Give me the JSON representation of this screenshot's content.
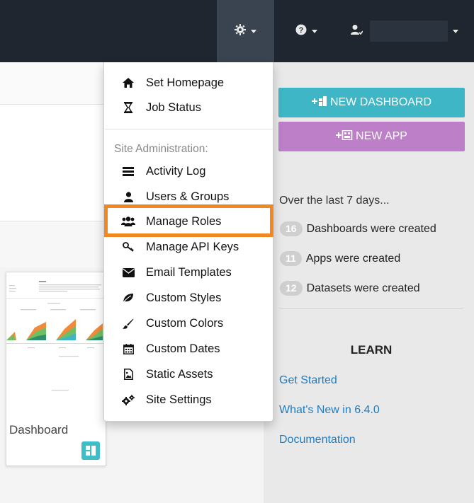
{
  "colors": {
    "topbar": "#1f2630",
    "settings_active": "#394450",
    "new_dashboard_button": "#3fb6c5",
    "new_app_button": "#bd7fc7",
    "link": "#1f7cc2",
    "highlight": "#f18721",
    "stat_pill": "#cfcfcf"
  },
  "topbar": {
    "settings_icon": "gear-icon",
    "help_icon": "question-circle-icon",
    "user_icon": "user-icon"
  },
  "menu": {
    "items_top": [
      {
        "icon": "home-icon",
        "label": "Set Homepage"
      },
      {
        "icon": "hourglass-icon",
        "label": "Job Status"
      }
    ],
    "section_header": "Site Administration:",
    "items_admin": [
      {
        "icon": "list-icon",
        "label": "Activity Log"
      },
      {
        "icon": "user-icon",
        "label": "Users & Groups"
      },
      {
        "icon": "users-icon",
        "label": "Manage Roles",
        "highlighted": true
      },
      {
        "icon": "key-icon",
        "label": "Manage API Keys"
      },
      {
        "icon": "envelope-icon",
        "label": "Email Templates"
      },
      {
        "icon": "leaf-icon",
        "label": "Custom Styles"
      },
      {
        "icon": "paintbrush-icon",
        "label": "Custom Colors"
      },
      {
        "icon": "calendar-icon",
        "label": "Custom Dates"
      },
      {
        "icon": "image-file-icon",
        "label": "Static Assets"
      },
      {
        "icon": "cogs-icon",
        "label": "Site Settings"
      }
    ]
  },
  "right": {
    "new_dashboard": "NEW DASHBOARD",
    "new_app": "NEW APP",
    "over_text": "Over the last 7 days...",
    "stats": [
      {
        "count": "16",
        "label": "Dashboards were created"
      },
      {
        "count": "11",
        "label": "Apps were created"
      },
      {
        "count": "12",
        "label": "Datasets were created"
      }
    ],
    "learn_title": "LEARN",
    "learn_links": [
      "Get Started",
      "What's New in 6.4.0",
      "Documentation"
    ]
  },
  "card": {
    "title": "Dashboard",
    "icon": "dashboard-icon"
  }
}
